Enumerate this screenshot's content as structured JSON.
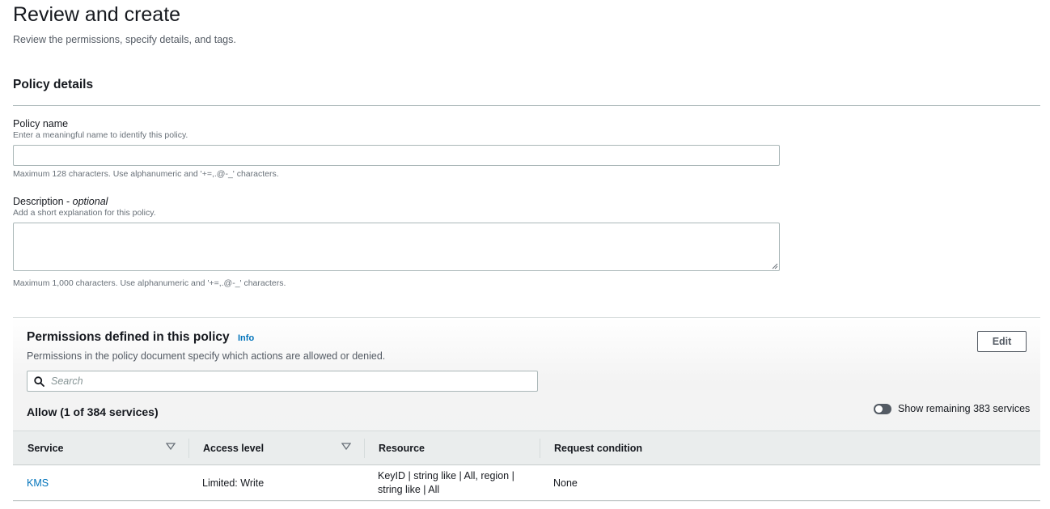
{
  "header": {
    "title": "Review and create",
    "subtitle": "Review the permissions, specify details, and tags."
  },
  "policy_details": {
    "title": "Policy details",
    "name_field": {
      "label": "Policy name",
      "description": "Enter a meaningful name to identify this policy.",
      "value": "",
      "constraint": "Maximum 128 characters. Use alphanumeric and '+=,.@-_' characters."
    },
    "description_field": {
      "label": "Description - ",
      "label_optional": "optional",
      "description": "Add a short explanation for this policy.",
      "value": "",
      "constraint": "Maximum 1,000 characters. Use alphanumeric and '+=,.@-_' characters."
    }
  },
  "permissions": {
    "title": "Permissions defined in this policy",
    "info_link": "Info",
    "description": "Permissions in the policy document specify which actions are allowed or denied.",
    "edit_label": "Edit",
    "search_placeholder": "Search",
    "allow_heading": "Allow (1 of 384 services)",
    "toggle_label": "Show remaining 383 services",
    "toggle_on": false,
    "columns": [
      "Service",
      "Access level",
      "Resource",
      "Request condition"
    ],
    "rows": [
      {
        "service": "KMS",
        "access_level": "Limited: Write",
        "resource_line1": "KeyID | string like | All, region |",
        "resource_line2": "string like | All",
        "request_condition": "None"
      }
    ]
  },
  "colors": {
    "link": "#0073bb",
    "text": "#16191f",
    "muted": "#687078",
    "border": "#aab7b8"
  }
}
